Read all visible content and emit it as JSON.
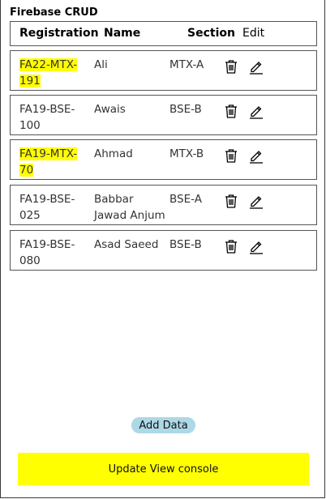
{
  "app": {
    "title": "Firebase CRUD"
  },
  "table": {
    "headers": {
      "registration": "Registration",
      "name": "Name",
      "section": "Section",
      "edit": "Edit"
    },
    "rows": [
      {
        "reg_line1": "FA22-MTX-",
        "reg_line2": "191",
        "name_line1": "Ali",
        "name_line2": "",
        "section": "MTX-A",
        "highlighted": true
      },
      {
        "reg_line1": "FA19-BSE-",
        "reg_line2": "100",
        "name_line1": "Awais",
        "name_line2": "",
        "section": "BSE-B",
        "highlighted": false
      },
      {
        "reg_line1": "FA19-MTX-",
        "reg_line2": "70",
        "name_line1": "Ahmad",
        "name_line2": "",
        "section": "MTX-B",
        "highlighted": true
      },
      {
        "reg_line1": "FA19-BSE-",
        "reg_line2": "025",
        "name_line1": "Babbar",
        "name_line2": "Jawad Anjum",
        "section": "BSE-A",
        "highlighted": false
      },
      {
        "reg_line1": "FA19-BSE-",
        "reg_line2": "080",
        "name_line1": "Asad Saeed",
        "name_line2": "",
        "section": "BSE-B",
        "highlighted": false
      }
    ],
    "row_icons": {
      "delete": "trash-icon",
      "edit": "pencil-icon"
    }
  },
  "buttons": {
    "add_label": "Add Data",
    "update_label": "Update View console"
  },
  "colors": {
    "highlight": "#ffff00",
    "add_button": "#add8e6",
    "update_button": "#ffff00"
  }
}
